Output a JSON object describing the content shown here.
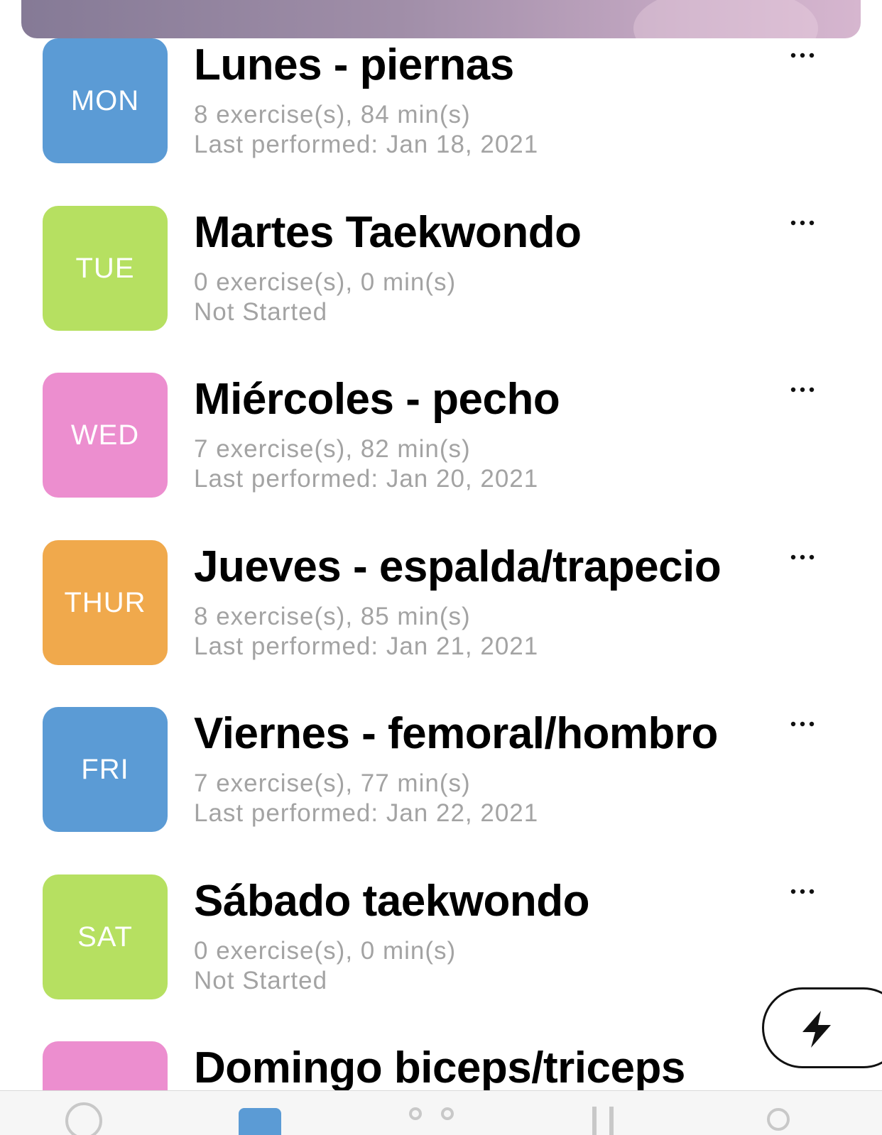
{
  "workouts": [
    {
      "day": "MON",
      "color": "#5b9bd5",
      "title": "Lunes - piernas",
      "stats": "8 exercise(s), 84 min(s)",
      "status": "Last performed: Jan 18, 2021"
    },
    {
      "day": "TUE",
      "color": "#b6e061",
      "title": "Martes Taekwondo",
      "stats": "0 exercise(s), 0 min(s)",
      "status": "Not Started"
    },
    {
      "day": "WED",
      "color": "#ec8ecf",
      "title": "Miércoles - pecho",
      "stats": "7 exercise(s), 82 min(s)",
      "status": "Last performed: Jan 20, 2021"
    },
    {
      "day": "THUR",
      "color": "#f0a94c",
      "title": "Jueves - espalda/trapecio",
      "stats": "8 exercise(s), 85 min(s)",
      "status": "Last performed: Jan 21, 2021"
    },
    {
      "day": "FRI",
      "color": "#5b9bd5",
      "title": "Viernes - femoral/hombro",
      "stats": "7 exercise(s), 77 min(s)",
      "status": "Last performed: Jan 22, 2021"
    },
    {
      "day": "SAT",
      "color": "#b6e061",
      "title": "Sábado taekwondo",
      "stats": "0 exercise(s), 0 min(s)",
      "status": "Not Started"
    },
    {
      "day": "",
      "color": "#ec8ecf",
      "title": "Domingo biceps/triceps",
      "stats": "",
      "status": ""
    }
  ],
  "icons": {
    "more": "ellipsis-icon",
    "quick_start": "lightning-bolt-icon"
  },
  "colors": {
    "title_text": "#000000",
    "meta_text": "#a3a3a3",
    "tab_active": "#5b9bd5",
    "tab_inactive": "#c8c8c8"
  }
}
